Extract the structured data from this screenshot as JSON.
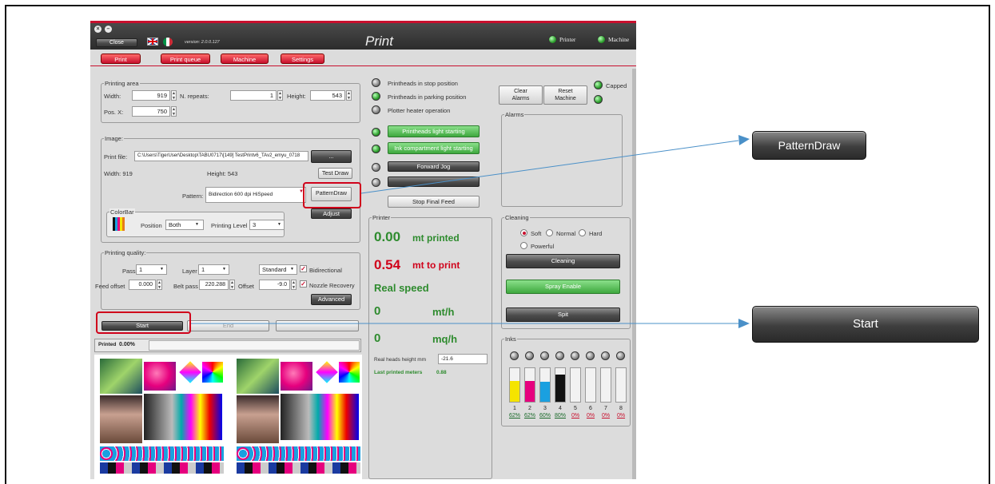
{
  "window": {
    "title": "Print",
    "close_label": "Close",
    "version": "version: 2.0.0.127",
    "status_printer": "Printer",
    "status_machine": "Machine"
  },
  "tabs": [
    "Print",
    "Print queue",
    "Machine",
    "Settings"
  ],
  "printing_area": {
    "title": "Printing area",
    "width_label": "Width:",
    "width_value": "919",
    "repeats_label": "N. repeats:",
    "repeats_value": "1",
    "height_label": "Height:",
    "height_value": "543",
    "posx_label": "Pos. X:",
    "posx_value": "750"
  },
  "image": {
    "title": "Image:",
    "file_label": "Print file:",
    "file_value": "C:\\Users\\TigerUser\\Desktop\\TABU0717\\[149] TestPrintv6_TAv2_emyu_0718",
    "browse_label": "...",
    "width_text": "Width: 919",
    "height_text": "Height: 543",
    "test_draw_label": "Test Draw",
    "pattern_label": "Pattern:",
    "pattern_value": "Bidirection 600 dpi HiSpeed",
    "pattern_draw_label": "PatternDraw",
    "adjust_label": "Adjust"
  },
  "colorbar": {
    "title": "ColorBar",
    "position_label": "Position",
    "position_value": "Both",
    "level_label": "Printing Level",
    "level_value": "3"
  },
  "quality": {
    "title": "Printing quality:",
    "pass_label": "Pass",
    "pass_value": "1",
    "layer_label": "Layer",
    "layer_value": "1",
    "mode_value": "Standard",
    "bidirectional_label": "Bidirectional",
    "feed_label": "Feed offset",
    "feed_value": "0.000",
    "belt_label": "Belt pass",
    "belt_value": "220.288",
    "offset_label": "Offset",
    "offset_value": "-9.0",
    "nozzle_label": "Nozzle Recovery",
    "advanced_label": "Advanced"
  },
  "actions": {
    "start_label": "Start",
    "end_label": "End"
  },
  "progress": {
    "printed_label": "Printed",
    "printed_value": "0.00%"
  },
  "status": {
    "stop_position": "Printheads in stop position",
    "parking_position": "Printheads in parking position",
    "heater": "Plotter heater operation",
    "heads_light": "Printheads light starting",
    "ink_light": "Ink compartment light starting",
    "forward_jog": "Forward Jog",
    "stop_final_feed": "Stop Final Feed"
  },
  "alarms": {
    "clear_label_1": "Clear",
    "clear_label_2": "Alarms",
    "reset_label_1": "Reset",
    "reset_label_2": "Machine",
    "capped_label": "Capped",
    "title": "Alarms"
  },
  "printer": {
    "title": "Printer",
    "printed_value": "0.00",
    "printed_unit": "mt printed",
    "to_print_value": "0.54",
    "to_print_unit": "mt to print",
    "real_speed_label": "Real speed",
    "speed1_value": "0",
    "speed1_unit": "mt/h",
    "speed2_value": "0",
    "speed2_unit": "mq/h",
    "heads_height_label": "Real heads height mm",
    "heads_height_value": "-21.6",
    "last_printed_label": "Last printed meters",
    "last_printed_value": "0.88"
  },
  "cleaning": {
    "title": "Cleaning",
    "soft": "Soft",
    "normal": "Normal",
    "hard": "Hard",
    "powerful": "Powerful",
    "cleaning_label": "Cleaning",
    "spray_label": "Spray Enable",
    "spit_label": "Spit"
  },
  "inks": {
    "title": "Inks",
    "channels": [
      {
        "num": "1",
        "pct": "62%",
        "level": 0.62,
        "color": "#f5e400"
      },
      {
        "num": "2",
        "pct": "62%",
        "level": 0.62,
        "color": "#e6007e"
      },
      {
        "num": "3",
        "pct": "60%",
        "level": 0.6,
        "color": "#1aa0e0"
      },
      {
        "num": "4",
        "pct": "80%",
        "level": 0.8,
        "color": "#111111"
      },
      {
        "num": "5",
        "pct": "0%",
        "level": 0,
        "color": "#cccccc"
      },
      {
        "num": "6",
        "pct": "0%",
        "level": 0,
        "color": "#cccccc"
      },
      {
        "num": "7",
        "pct": "0%",
        "level": 0,
        "color": "#cccccc"
      },
      {
        "num": "8",
        "pct": "0%",
        "level": 0,
        "color": "#cccccc"
      }
    ]
  },
  "callouts": {
    "pattern_draw": "PatternDraw",
    "start": "Start"
  },
  "colors": {
    "accent_red": "#c8102e",
    "ok_green": "#2e8b2e",
    "alert_red": "#d0021b",
    "pointer_blue": "#4a90c8"
  }
}
